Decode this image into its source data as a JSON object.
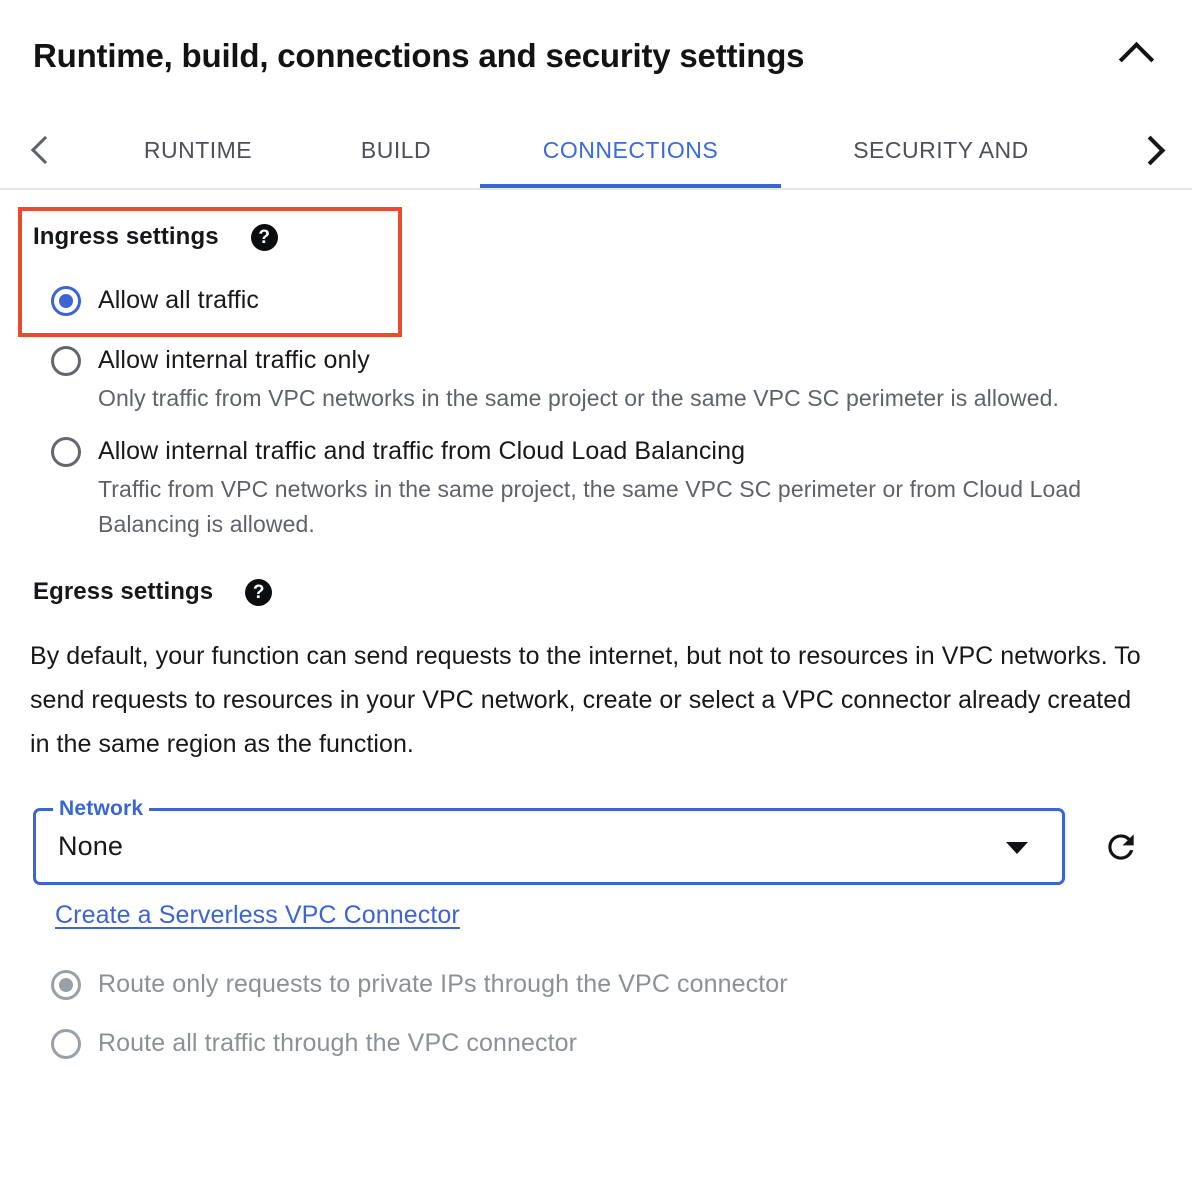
{
  "header": {
    "title": "Runtime, build, connections and security settings",
    "collapse_icon": "chevron-up-icon"
  },
  "tabbar": {
    "scroll_left_icon": "chevron-left-icon",
    "scroll_right_icon": "chevron-right-icon",
    "tabs": [
      {
        "label": "RUNTIME",
        "active": false
      },
      {
        "label": "BUILD",
        "active": false
      },
      {
        "label": "CONNECTIONS",
        "active": true
      },
      {
        "label": "SECURITY AND",
        "active": false
      }
    ],
    "active_tab": "CONNECTIONS"
  },
  "ingress": {
    "heading": "Ingress settings",
    "help_icon": "help-circle-icon",
    "options": [
      {
        "label": "Allow all traffic",
        "description": "",
        "selected": true
      },
      {
        "label": "Allow internal traffic only",
        "description": "Only traffic from VPC networks in the same project or the same VPC SC perimeter is allowed.",
        "selected": false
      },
      {
        "label": "Allow internal traffic and traffic from Cloud Load Balancing",
        "description": "Traffic from VPC networks in the same project, the same VPC SC perimeter or from Cloud Load Balancing is allowed.",
        "selected": false
      }
    ]
  },
  "egress": {
    "heading": "Egress settings",
    "help_icon": "help-circle-icon",
    "paragraph": " By default, your function can send requests to the internet, but not to resources in VPC networks. To send requests to resources in your VPC network, create or select a VPC connector already created in the same region as the function.",
    "network_field": {
      "label": "Network",
      "value": "None",
      "dropdown_icon": "chevron-down-icon",
      "refresh_icon": "refresh-icon"
    },
    "create_connector_link": "Create a Serverless VPC Connector",
    "routing_options": [
      {
        "label": "Route only requests to private IPs through the VPC connector",
        "selected": true,
        "disabled": true
      },
      {
        "label": "Route all traffic through the VPC connector",
        "selected": false,
        "disabled": true
      }
    ]
  },
  "colors": {
    "accent_blue": "#3b65d4",
    "highlight_red": "#ea4a2f",
    "muted_text": "#5f6368",
    "disabled_text": "#8c9196"
  }
}
